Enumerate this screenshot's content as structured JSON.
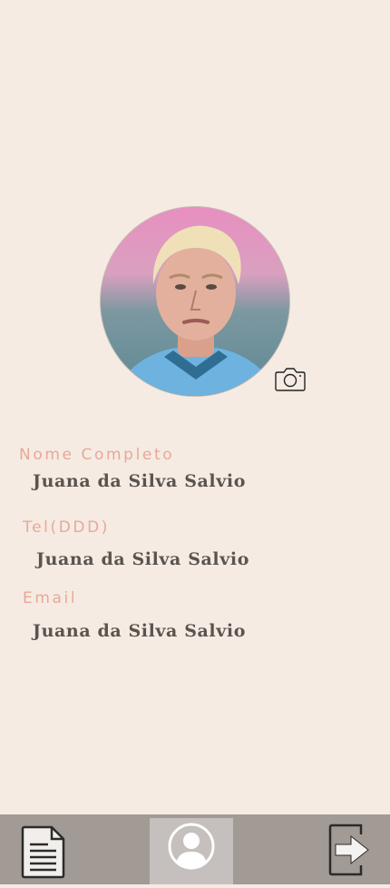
{
  "profile": {
    "photo_icon": "user-photo",
    "camera_icon": "camera-icon"
  },
  "fields": {
    "name_label": "Nome Completo",
    "name_value": "Juana da Silva Salvio",
    "phone_label": "Tel(DDD)",
    "phone_value": "Juana da Silva Salvio",
    "email_label": "Email",
    "email_value": "Juana da Silva Salvio"
  },
  "nav": {
    "items": [
      {
        "icon": "document-icon",
        "active": false
      },
      {
        "icon": "user-icon",
        "active": true
      },
      {
        "icon": "logout-icon",
        "active": false
      }
    ]
  },
  "colors": {
    "background": "#f5ebe2",
    "label": "#e8a899",
    "value": "#5a5451",
    "nav": "#a19a95",
    "nav_active": "#c5c0bd"
  }
}
